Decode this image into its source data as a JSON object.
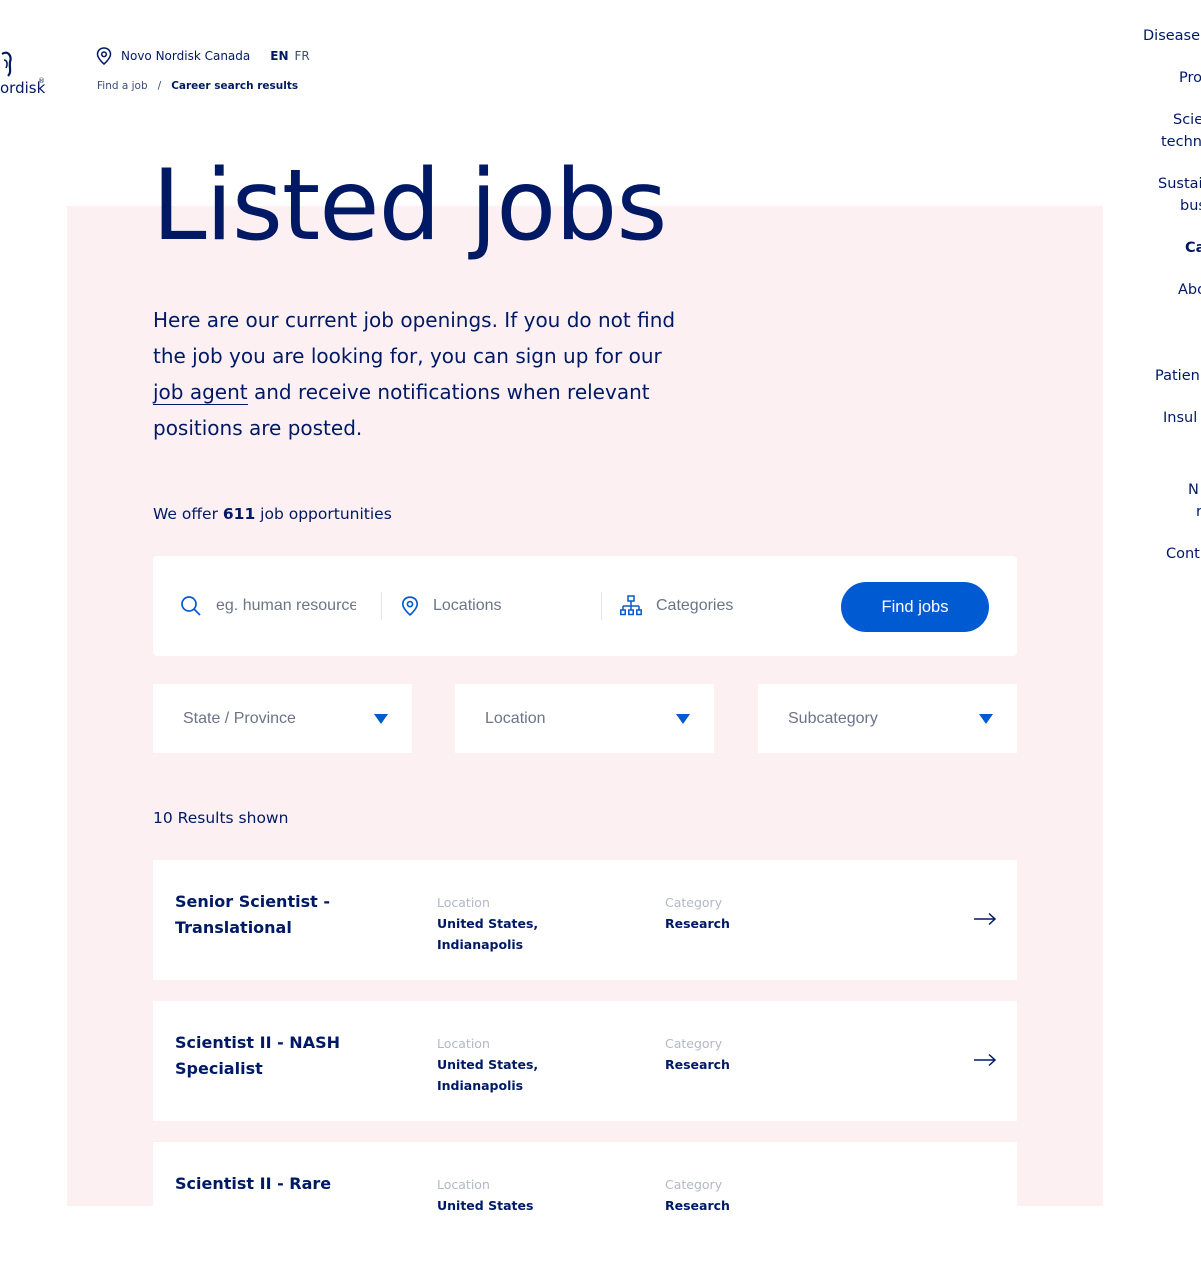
{
  "brand": {
    "logo_text": "ordisk",
    "reg_mark": "®"
  },
  "topbar": {
    "site": "Novo Nordisk Canada",
    "lang_active": "EN",
    "lang_other": "FR"
  },
  "breadcrumb": {
    "item1": "Find a job",
    "separator": "/",
    "current": "Career search results"
  },
  "hero": {
    "title": "Listed jobs"
  },
  "intro": {
    "part1": "Here are our current job openings. If you do not find the job you are looking for, you can sign up for our ",
    "link": "job agent",
    "part2": " and receive notifications when relevant positions are posted."
  },
  "offer": {
    "prefix": "We offer ",
    "count": "611",
    "suffix": " job opportunities"
  },
  "search": {
    "keyword_placeholder": "eg. human resources",
    "locations_label": "Locations",
    "categories_label": "Categories",
    "find_button": "Find jobs"
  },
  "filters": {
    "state": "State / Province",
    "location": "Location",
    "subcategory": "Subcategory"
  },
  "results": {
    "label": "10 Results shown"
  },
  "jobs": [
    {
      "title": "Senior Scientist - Translational",
      "location_key": "Location",
      "location": "United States, Indianapolis",
      "category_key": "Category",
      "category": "Research"
    },
    {
      "title": "Scientist II - NASH Specialist",
      "location_key": "Location",
      "location": "United States, Indianapolis",
      "category_key": "Category",
      "category": "Research"
    },
    {
      "title": "Scientist II - Rare",
      "location_key": "Location",
      "location": "United States",
      "category_key": "Category",
      "category": "Research"
    }
  ],
  "sidenav": [
    "Disease",
    "Pro",
    "Scie",
    "techn",
    "Sustai",
    "bus",
    "Ca",
    "Abo",
    "Patien",
    "Insul",
    "N",
    "r",
    "Cont"
  ],
  "colors": {
    "navy": "#001965",
    "accent": "#005ad2",
    "pink_bg": "#fcf0f3"
  }
}
